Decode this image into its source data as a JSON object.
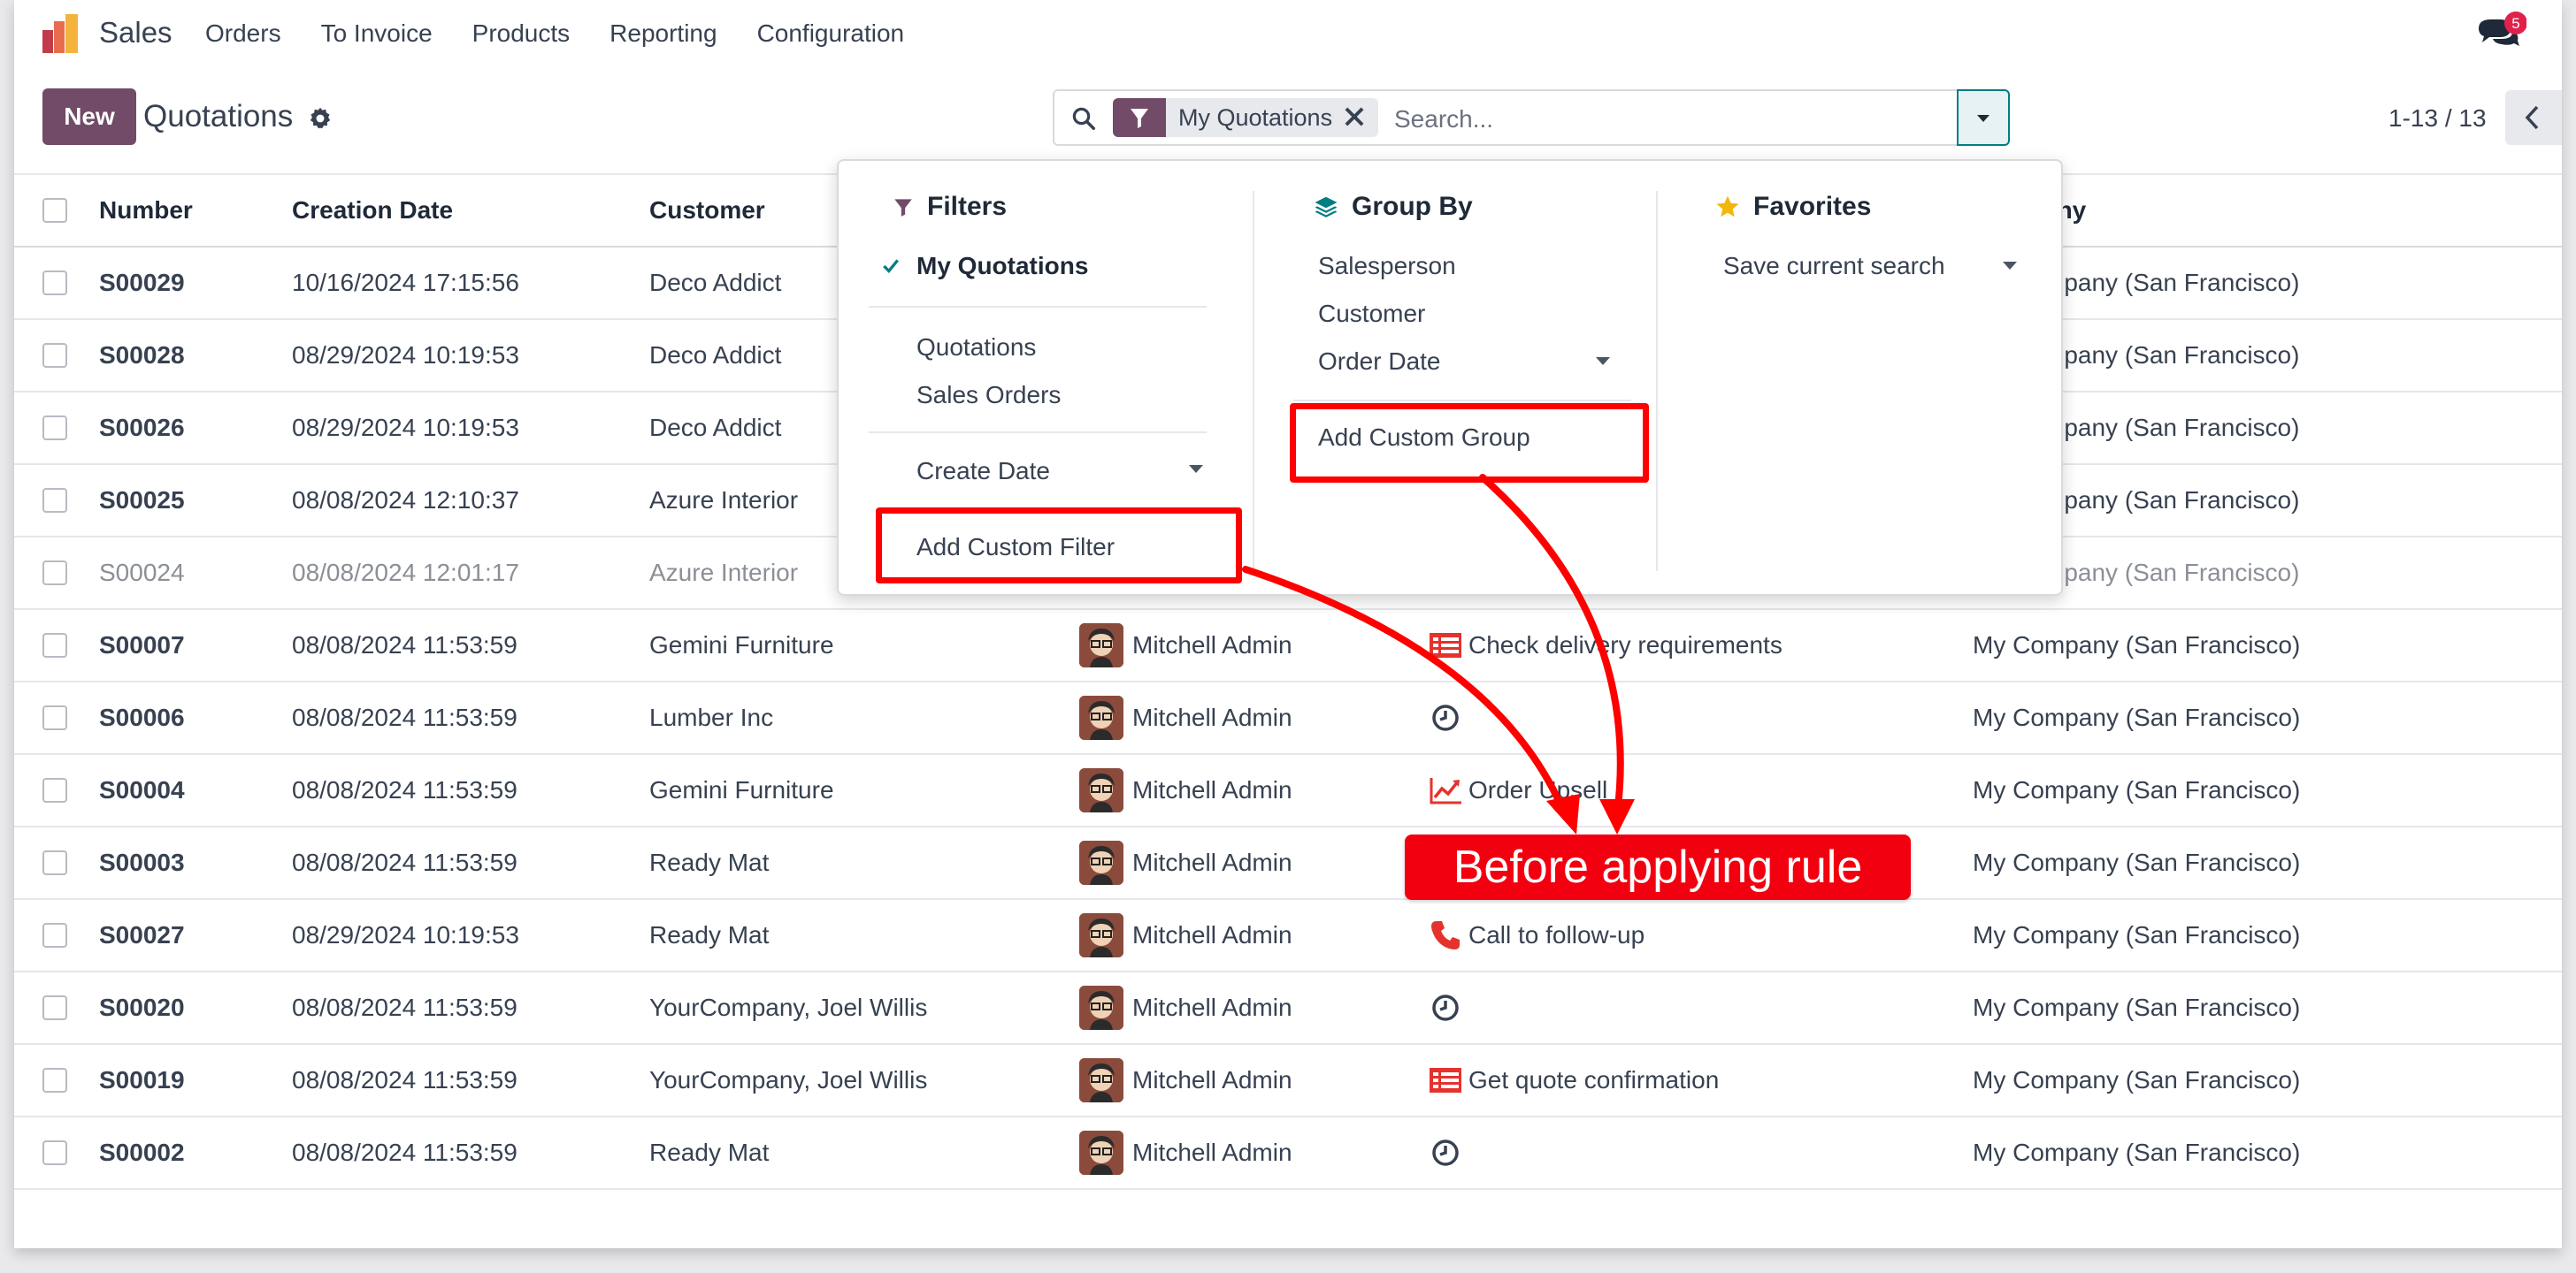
{
  "navbar": {
    "brand": "Sales",
    "menu": [
      "Orders",
      "To Invoice",
      "Products",
      "Reporting",
      "Configuration"
    ],
    "chat_badge": "5"
  },
  "control": {
    "new_label": "New",
    "breadcrumb": "Quotations",
    "facet_label": "My Quotations",
    "search_placeholder": "Search...",
    "pager": "1-13 / 13"
  },
  "table": {
    "headers": {
      "number": "Number",
      "creation_date": "Creation Date",
      "customer": "Customer",
      "company": "any"
    },
    "rows": [
      {
        "number": "S00029",
        "date": "10/16/2024 17:15:56",
        "customer": "Deco Addict",
        "salesperson": "",
        "activity": "",
        "activity_icon": "",
        "company": "mpany (San Francisco)",
        "dim": false
      },
      {
        "number": "S00028",
        "date": "08/29/2024 10:19:53",
        "customer": "Deco Addict",
        "salesperson": "",
        "activity": "",
        "activity_icon": "",
        "company": "mpany (San Francisco)",
        "dim": false
      },
      {
        "number": "S00026",
        "date": "08/29/2024 10:19:53",
        "customer": "Deco Addict",
        "salesperson": "",
        "activity": "",
        "activity_icon": "",
        "company": "mpany (San Francisco)",
        "dim": false
      },
      {
        "number": "S00025",
        "date": "08/08/2024 12:10:37",
        "customer": "Azure Interior",
        "salesperson": "",
        "activity": "",
        "activity_icon": "",
        "company": "mpany (San Francisco)",
        "dim": false
      },
      {
        "number": "S00024",
        "date": "08/08/2024 12:01:17",
        "customer": "Azure Interior",
        "salesperson": "",
        "activity": "",
        "activity_icon": "",
        "company": "mpany (San Francisco)",
        "dim": true
      },
      {
        "number": "S00007",
        "date": "08/08/2024 11:53:59",
        "customer": "Gemini Furniture",
        "salesperson": "Mitchell Admin",
        "activity": "Check delivery requirements",
        "activity_icon": "todo-icon",
        "company": "My Company (San Francisco)",
        "dim": false
      },
      {
        "number": "S00006",
        "date": "08/08/2024 11:53:59",
        "customer": "Lumber Inc",
        "salesperson": "Mitchell Admin",
        "activity": "",
        "activity_icon": "clock-icon",
        "company": "My Company (San Francisco)",
        "dim": false
      },
      {
        "number": "S00004",
        "date": "08/08/2024 11:53:59",
        "customer": "Gemini Furniture",
        "salesperson": "Mitchell Admin",
        "activity": "Order Upsell",
        "activity_icon": "chart-line-icon",
        "company": "My Company (San Francisco)",
        "dim": false
      },
      {
        "number": "S00003",
        "date": "08/08/2024 11:53:59",
        "customer": "Ready Mat",
        "salesperson": "Mitchell Admin",
        "activity": "",
        "activity_icon": "",
        "company": "My Company (San Francisco)",
        "dim": false
      },
      {
        "number": "S00027",
        "date": "08/29/2024 10:19:53",
        "customer": "Ready Mat",
        "salesperson": "Mitchell Admin",
        "activity": "Call to follow-up",
        "activity_icon": "phone-icon",
        "company": "My Company (San Francisco)",
        "dim": false
      },
      {
        "number": "S00020",
        "date": "08/08/2024 11:53:59",
        "customer": "YourCompany, Joel Willis",
        "salesperson": "Mitchell Admin",
        "activity": "",
        "activity_icon": "clock-icon",
        "company": "My Company (San Francisco)",
        "dim": false
      },
      {
        "number": "S00019",
        "date": "08/08/2024 11:53:59",
        "customer": "YourCompany, Joel Willis",
        "salesperson": "Mitchell Admin",
        "activity": "Get quote confirmation",
        "activity_icon": "todo-icon",
        "company": "My Company (San Francisco)",
        "dim": false
      },
      {
        "number": "S00002",
        "date": "08/08/2024 11:53:59",
        "customer": "Ready Mat",
        "salesperson": "Mitchell Admin",
        "activity": "",
        "activity_icon": "clock-icon",
        "company": "My Company (San Francisco)",
        "dim": false
      }
    ]
  },
  "dropdown": {
    "filters": {
      "title": "Filters",
      "my_quotations": "My Quotations",
      "quotations": "Quotations",
      "sales_orders": "Sales Orders",
      "create_date": "Create Date",
      "add_custom_filter": "Add Custom Filter"
    },
    "group_by": {
      "title": "Group By",
      "salesperson": "Salesperson",
      "customer": "Customer",
      "order_date": "Order Date",
      "add_custom_group": "Add Custom Group"
    },
    "favorites": {
      "title": "Favorites",
      "save_current_search": "Save current search"
    }
  },
  "annotation": {
    "label": "Before applying rule"
  },
  "colors": {
    "brand": "#714b67",
    "accent": "#017e84",
    "highlight": "#ff0000"
  }
}
